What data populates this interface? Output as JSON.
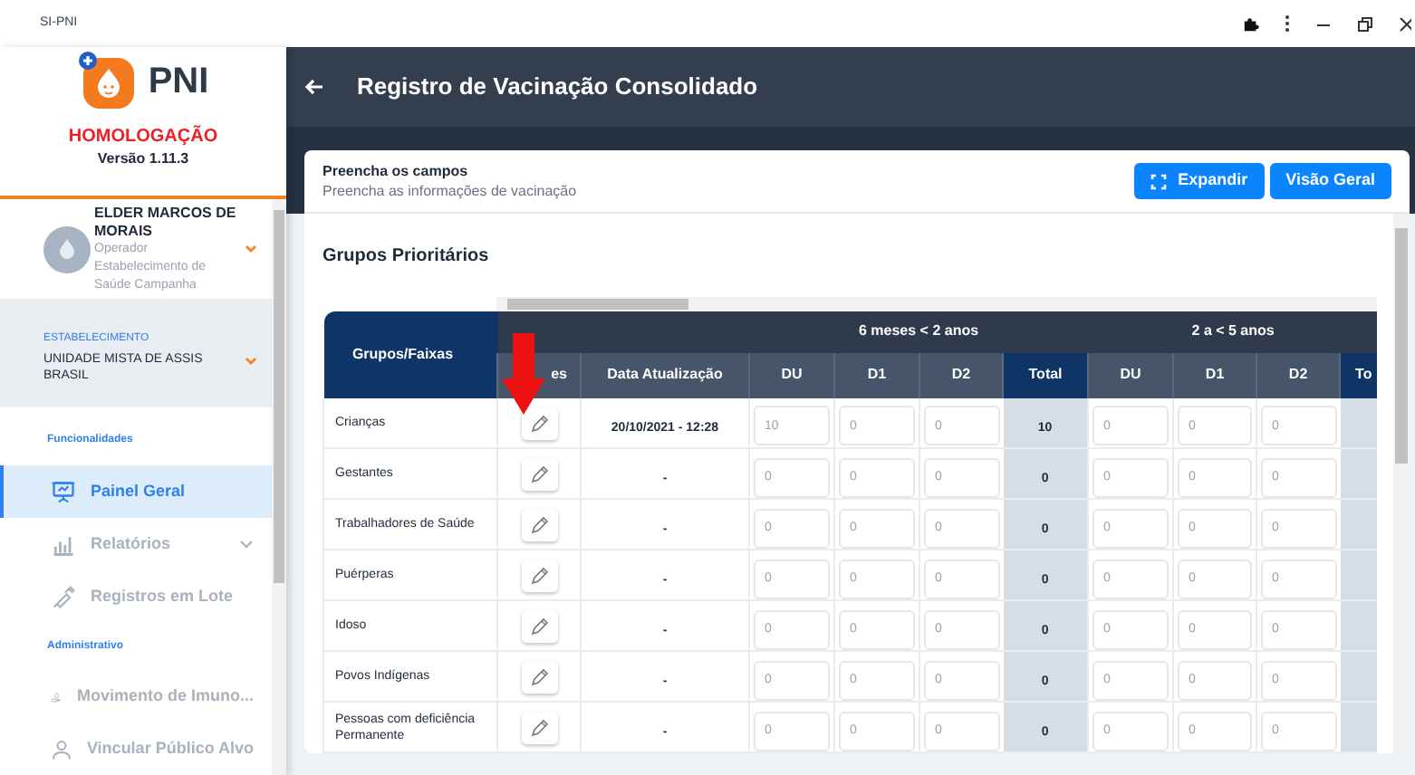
{
  "window": {
    "title": "SI-PNI"
  },
  "sidebar": {
    "logo_text": "PNI",
    "environment": "HOMOLOGAÇÃO",
    "version": "Versão 1.11.3",
    "user": {
      "name": "ELDER MARCOS DE MORAIS",
      "role": "Operador Estabelecimento de Saúde Campanha"
    },
    "establishment": {
      "label": "ESTABELECIMENTO",
      "name": "UNIDADE MISTA DE ASSIS BRASIL"
    },
    "sections": [
      {
        "title": "Funcionalidades",
        "items": [
          {
            "label": "Painel Geral",
            "selected": true,
            "has_submenu": false
          },
          {
            "label": "Relatórios",
            "selected": false,
            "has_submenu": true
          },
          {
            "label": "Registros em Lote",
            "selected": false,
            "has_submenu": false
          }
        ]
      },
      {
        "title": "Administrativo",
        "items": [
          {
            "label": "Movimento de Imuno...",
            "selected": false,
            "has_submenu": false
          },
          {
            "label": "Vincular Público Alvo",
            "selected": false,
            "has_submenu": false
          }
        ]
      }
    ]
  },
  "header": {
    "title": "Registro de Vacinação Consolidado"
  },
  "card": {
    "heading": "Preencha os campos",
    "subheading": "Preencha as informações de vacinação",
    "buttons": [
      {
        "label": "Expandir",
        "kind": "expand"
      },
      {
        "label": "Visão Geral",
        "kind": "plain"
      }
    ]
  },
  "section_title": "Grupos Prioritários",
  "table": {
    "bands": [
      {
        "label": "6 meses < 2 anos"
      },
      {
        "label": "2 a < 5 anos"
      }
    ],
    "columns": [
      {
        "label": "Grupos/Faixas",
        "kind": "group"
      },
      {
        "label": "es",
        "kind": "action"
      },
      {
        "label": "Data Atualização",
        "kind": "date"
      },
      {
        "label": "DU",
        "kind": "dose"
      },
      {
        "label": "D1",
        "kind": "dose"
      },
      {
        "label": "D2",
        "kind": "dose"
      },
      {
        "label": "Total",
        "kind": "total"
      },
      {
        "label": "DU",
        "kind": "dose"
      },
      {
        "label": "D1",
        "kind": "dose"
      },
      {
        "label": "D2",
        "kind": "dose"
      },
      {
        "label": "To",
        "kind": "total"
      }
    ],
    "rows": [
      {
        "cells": [
          "Crianças",
          "",
          "20/10/2021 - 12:28",
          "10",
          "0",
          "0",
          "10",
          "0",
          "0",
          "0",
          ""
        ]
      },
      {
        "cells": [
          "Gestantes",
          "",
          "-",
          "0",
          "0",
          "0",
          "0",
          "0",
          "0",
          "0",
          ""
        ]
      },
      {
        "cells": [
          "Trabalhadores de Saúde",
          "",
          "-",
          "0",
          "0",
          "0",
          "0",
          "0",
          "0",
          "0",
          ""
        ]
      },
      {
        "cells": [
          "Puérperas",
          "",
          "-",
          "0",
          "0",
          "0",
          "0",
          "0",
          "0",
          "0",
          ""
        ]
      },
      {
        "cells": [
          "Idoso",
          "",
          "-",
          "0",
          "0",
          "0",
          "0",
          "0",
          "0",
          "0",
          ""
        ]
      },
      {
        "cells": [
          "Povos Indígenas",
          "",
          "-",
          "0",
          "0",
          "0",
          "0",
          "0",
          "0",
          "0",
          ""
        ]
      },
      {
        "cells": [
          "Pessoas com deficiência Permanente",
          "",
          "-",
          "0",
          "0",
          "0",
          "0",
          "0",
          "0",
          "0",
          ""
        ]
      }
    ]
  }
}
